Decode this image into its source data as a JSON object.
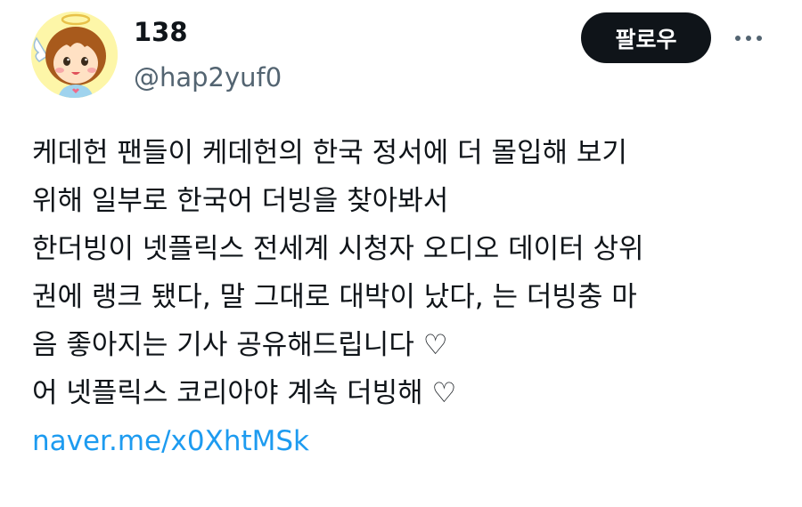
{
  "author": {
    "display_name": "138",
    "handle": "@hap2yuf0",
    "avatar_icon": "angel-girl-avatar"
  },
  "actions": {
    "follow_label": "팔로우",
    "more_icon": "more-dots-icon"
  },
  "tweet": {
    "lines": [
      "케데헌 팬들이 케데헌의 한국 정서에 더 몰입해 보기",
      "위해 일부로 한국어 더빙을 찾아봐서",
      "한더빙이 넷플릭스 전세계 시청자 오디오 데이터 상위",
      "권에 랭크 됐다, 말 그대로 대박이 났다, 는 더빙충 마",
      "음 좋아지는 기사 공유해드립니다 ♡",
      "어 넷플릭스 코리아야 계속 더빙해 ♡"
    ],
    "link": "naver.me/x0XhtMSk"
  },
  "colors": {
    "text": "#0f1419",
    "secondary": "#536471",
    "link": "#1d9bf0",
    "follow_bg": "#0f1419"
  }
}
